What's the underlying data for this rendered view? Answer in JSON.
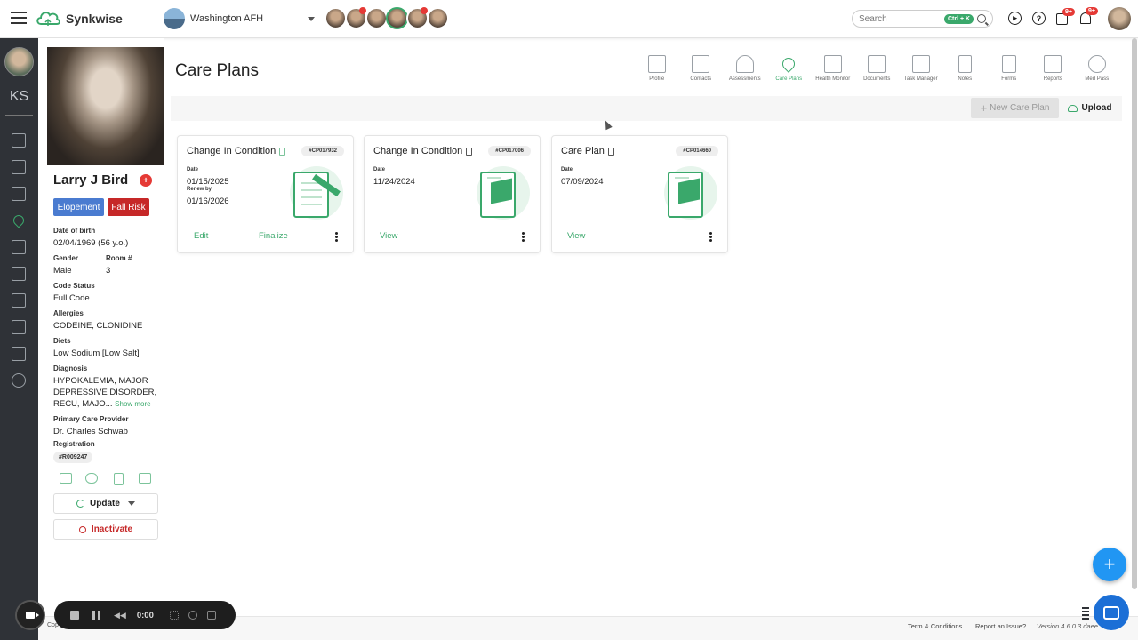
{
  "app": {
    "name": "Synkwise"
  },
  "facility": {
    "name": "Washington AFH"
  },
  "search": {
    "placeholder": "Search",
    "shortcut": "Ctrl + K"
  },
  "notifications": {
    "calendar_badge": "9+",
    "bell_badge": "9+"
  },
  "user": {
    "initials": "KS"
  },
  "resident": {
    "name": "Larry J Bird",
    "tags": [
      "Elopement",
      "Fall Risk"
    ],
    "dob_label": "Date of birth",
    "dob": "02/04/1969 (56 y.o.)",
    "gender_label": "Gender",
    "gender": "Male",
    "room_label": "Room #",
    "room": "3",
    "code_status_label": "Code Status",
    "code_status": "Full Code",
    "allergies_label": "Allergies",
    "allergies": "CODEINE, CLONIDINE",
    "diets_label": "Diets",
    "diets": "Low Sodium [Low Salt]",
    "diagnosis_label": "Diagnosis",
    "diagnosis_line1": "HYPOKALEMIA, MAJOR",
    "diagnosis_line2": "DEPRESSIVE DISORDER,",
    "diagnosis_line3": "RECU, MAJO...",
    "show_more": "Show more",
    "pcp_label": "Primary Care Provider",
    "pcp": "Dr. Charles Schwab",
    "registration_label": "Registration",
    "registration": "#R009247",
    "update_label": "Update",
    "inactivate_label": "Inactivate"
  },
  "page": {
    "title": "Care Plans"
  },
  "tabs": [
    {
      "label": "Profile"
    },
    {
      "label": "Contacts"
    },
    {
      "label": "Assessments"
    },
    {
      "label": "Care Plans"
    },
    {
      "label": "Health Monitor"
    },
    {
      "label": "Documents"
    },
    {
      "label": "Task Manager"
    },
    {
      "label": "Notes"
    },
    {
      "label": "Forms"
    },
    {
      "label": "Reports"
    },
    {
      "label": "Med Pass"
    }
  ],
  "toolbar": {
    "new_label": "New Care Plan",
    "upload_label": "Upload"
  },
  "cards": [
    {
      "title": "Change In Condition",
      "code": "#CP017932",
      "date_label": "Date",
      "date": "01/15/2025",
      "renew_label": "Renew by",
      "renew": "01/16/2026",
      "actions": [
        "Edit",
        "Finalize"
      ]
    },
    {
      "title": "Change In Condition",
      "code": "#CP017006",
      "date_label": "Date",
      "date": "11/24/2024",
      "actions": [
        "View"
      ]
    },
    {
      "title": "Care Plan",
      "code": "#CP014660",
      "date_label": "Date",
      "date": "07/09/2024",
      "actions": [
        "View"
      ]
    }
  ],
  "footer": {
    "copyright": "Cop",
    "terms": "Term & Conditions",
    "report": "Report an Issue?",
    "version": "Version 4.6.0.3.daee"
  },
  "recorder": {
    "time": "0:00"
  },
  "colors": {
    "accent": "#3aa86b",
    "danger": "#c62828",
    "primary": "#4a7bd0",
    "fab": "#2196f3"
  }
}
